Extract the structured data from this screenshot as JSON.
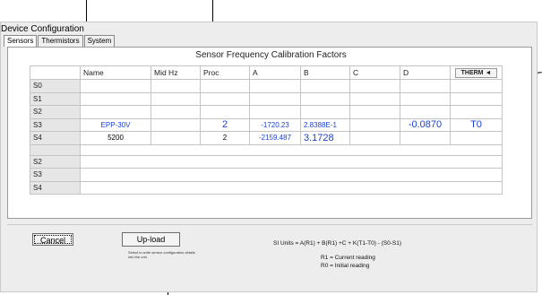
{
  "window": {
    "title": "Device Configuration"
  },
  "tabs": [
    {
      "label": "Sensors",
      "active": true
    },
    {
      "label": "Thermistors",
      "active": false
    },
    {
      "label": "System",
      "active": false
    }
  ],
  "panel": {
    "title": "Sensor Frequency Calibration Factors"
  },
  "table": {
    "headers": [
      "Name",
      "Mid Hz",
      "Proc",
      "A",
      "B",
      "C",
      "D"
    ],
    "therm_button": "THERM",
    "therm_arrow": "◄",
    "rows": [
      {
        "label": "S0",
        "name": "",
        "midhz": "",
        "proc": "",
        "a": "",
        "b": "",
        "c": "",
        "d": "",
        "therm": ""
      },
      {
        "label": "S1",
        "name": "",
        "midhz": "",
        "proc": "",
        "a": "",
        "b": "",
        "c": "",
        "d": "",
        "therm": ""
      },
      {
        "label": "S2",
        "name": "",
        "midhz": "",
        "proc": "",
        "a": "",
        "b": "",
        "c": "",
        "d": "",
        "therm": ""
      },
      {
        "label": "S3",
        "name": "EPP-30V",
        "midhz": "",
        "proc": "2",
        "a": "-1720.23",
        "b": "2.8388E-1",
        "c": "",
        "d": "-0.0870",
        "therm": "T0"
      },
      {
        "label": "S4",
        "name": "5200",
        "midhz": "",
        "proc": "2",
        "a": "-2159.487",
        "b": "3.1728",
        "c": "",
        "d": "",
        "therm": ""
      }
    ],
    "rows2": [
      {
        "label": "S2"
      },
      {
        "label": "S3"
      },
      {
        "label": "S4"
      }
    ]
  },
  "buttons": {
    "cancel": "Cancel",
    "upload": "Up-load",
    "upload_desc": "Select to write sensor configuration details into the unit"
  },
  "formula": {
    "text": "SI Units = A(R1) + B(R1) +C + K(T1-T0) - (S0-S1)",
    "legend1": "R1 = Current reading",
    "legend2": "R0 = Initial reading"
  },
  "colors": {
    "value_blue": "#1a3fd6",
    "window_bg": "#ededed"
  }
}
